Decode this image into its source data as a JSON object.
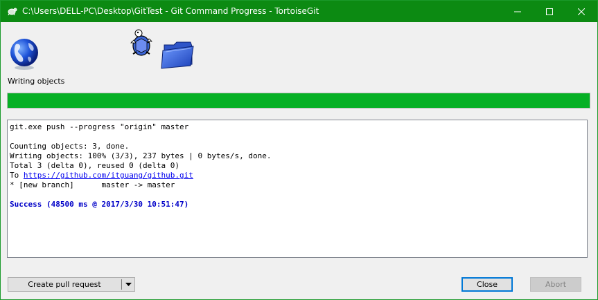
{
  "window": {
    "title": "C:\\Users\\DELL-PC\\Desktop\\GitTest - Git Command Progress - TortoiseGit",
    "accent": "#0c8a12"
  },
  "header": {
    "status": "Writing objects",
    "icons": [
      "tortoisegit-icon",
      "globe-icon",
      "turtle-icon",
      "folder-icon"
    ]
  },
  "progress": {
    "percent": 100,
    "color": "#06b025"
  },
  "log": {
    "lines": [
      "git.exe push --progress \"origin\" master",
      "",
      "Counting objects: 3, done.",
      "Writing objects: 100% (3/3), 237 bytes | 0 bytes/s, done.",
      "Total 3 (delta 0), reused 0 (delta 0)"
    ],
    "to_prefix": "To ",
    "to_url": "https://github.com/itguang/github.git",
    "branch_line": "* [new branch]      master -> master",
    "success": "Success (48500 ms @ 2017/3/30 10:51:47)",
    "success_color": "#0000c8"
  },
  "buttons": {
    "create_pull_request": "Create pull request",
    "close": "Close",
    "abort": "Abort"
  }
}
